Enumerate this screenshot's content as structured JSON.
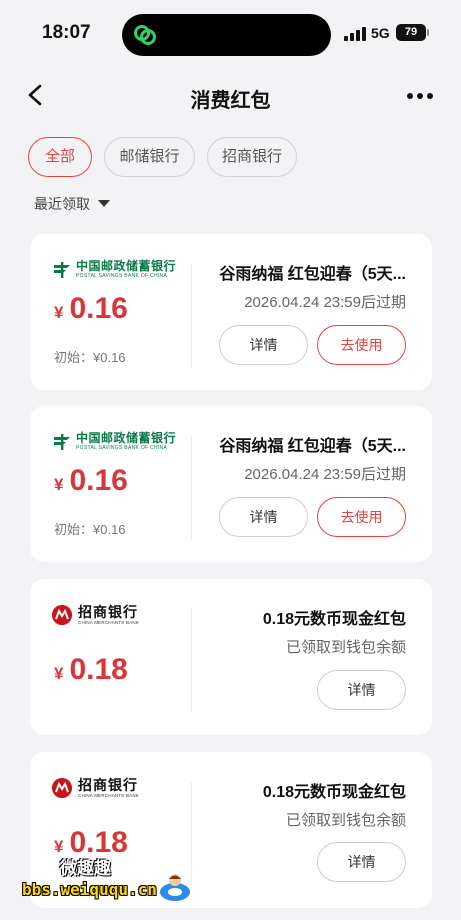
{
  "status_bar": {
    "time": "18:07",
    "network": "5G",
    "battery": "79"
  },
  "header": {
    "title": "消费红包"
  },
  "filters": {
    "chips": [
      "全部",
      "邮储银行",
      "招商银行"
    ],
    "active_index": 0
  },
  "sort": {
    "label": "最近领取"
  },
  "cards": [
    {
      "bank": "psbc",
      "bank_name_cn": "中国邮政储蓄银行",
      "bank_name_en": "POSTAL SAVINGS BANK OF CHINA",
      "currency": "¥",
      "amount": "0.16",
      "initial": "初始：¥0.16",
      "title": "谷雨纳福 红包迎春（5天...",
      "subtitle": "2026.04.24 23:59后过期",
      "detail_label": "详情",
      "use_label": "去使用"
    },
    {
      "bank": "psbc",
      "bank_name_cn": "中国邮政储蓄银行",
      "bank_name_en": "POSTAL SAVINGS BANK OF CHINA",
      "currency": "¥",
      "amount": "0.16",
      "initial": "初始：¥0.16",
      "title": "谷雨纳福 红包迎春（5天...",
      "subtitle": "2026.04.24 23:59后过期",
      "detail_label": "详情",
      "use_label": "去使用"
    },
    {
      "bank": "cmb",
      "bank_name_cn": "招商银行",
      "bank_name_en": "CHINA MERCHANTS BANK",
      "currency": "¥",
      "amount": "0.18",
      "title": "0.18元数币现金红包",
      "subtitle": "已领取到钱包余额",
      "detail_label": "详情"
    },
    {
      "bank": "cmb",
      "bank_name_cn": "招商银行",
      "bank_name_en": "CHINA MERCHANTS BANK",
      "currency": "¥",
      "amount": "0.18",
      "title": "0.18元数币现金红包",
      "subtitle": "已领取到钱包余额",
      "detail_label": "详情"
    }
  ],
  "watermark": {
    "top": "微趣趣",
    "url": "bbs.weiququ.cn"
  },
  "colors": {
    "accent": "#e0453f",
    "amount": "#d8373a",
    "psbc_green": "#0a7a47",
    "cmb_red": "#c8151d",
    "background": "#f3f3f5"
  },
  "icons": [
    "app-link-icon",
    "signal-icon",
    "battery-icon",
    "back-arrow-icon",
    "more-dots-icon",
    "caret-down-icon",
    "psbc-logo-icon",
    "cmb-logo-icon"
  ]
}
